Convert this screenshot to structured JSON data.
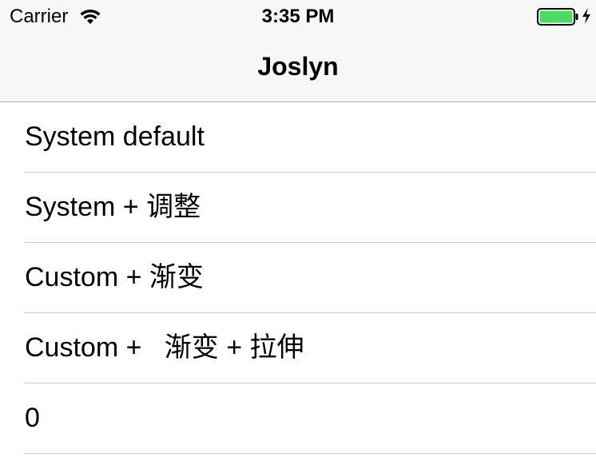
{
  "status_bar": {
    "carrier": "Carrier",
    "time": "3:35 PM",
    "battery_color": "#4cd964"
  },
  "nav": {
    "title": "Joslyn"
  },
  "rows": [
    {
      "label": "System default"
    },
    {
      "label": "System + 调整"
    },
    {
      "label": "Custom + 渐变"
    },
    {
      "label": "Custom +   渐变 + 拉伸"
    },
    {
      "label": "0"
    }
  ]
}
